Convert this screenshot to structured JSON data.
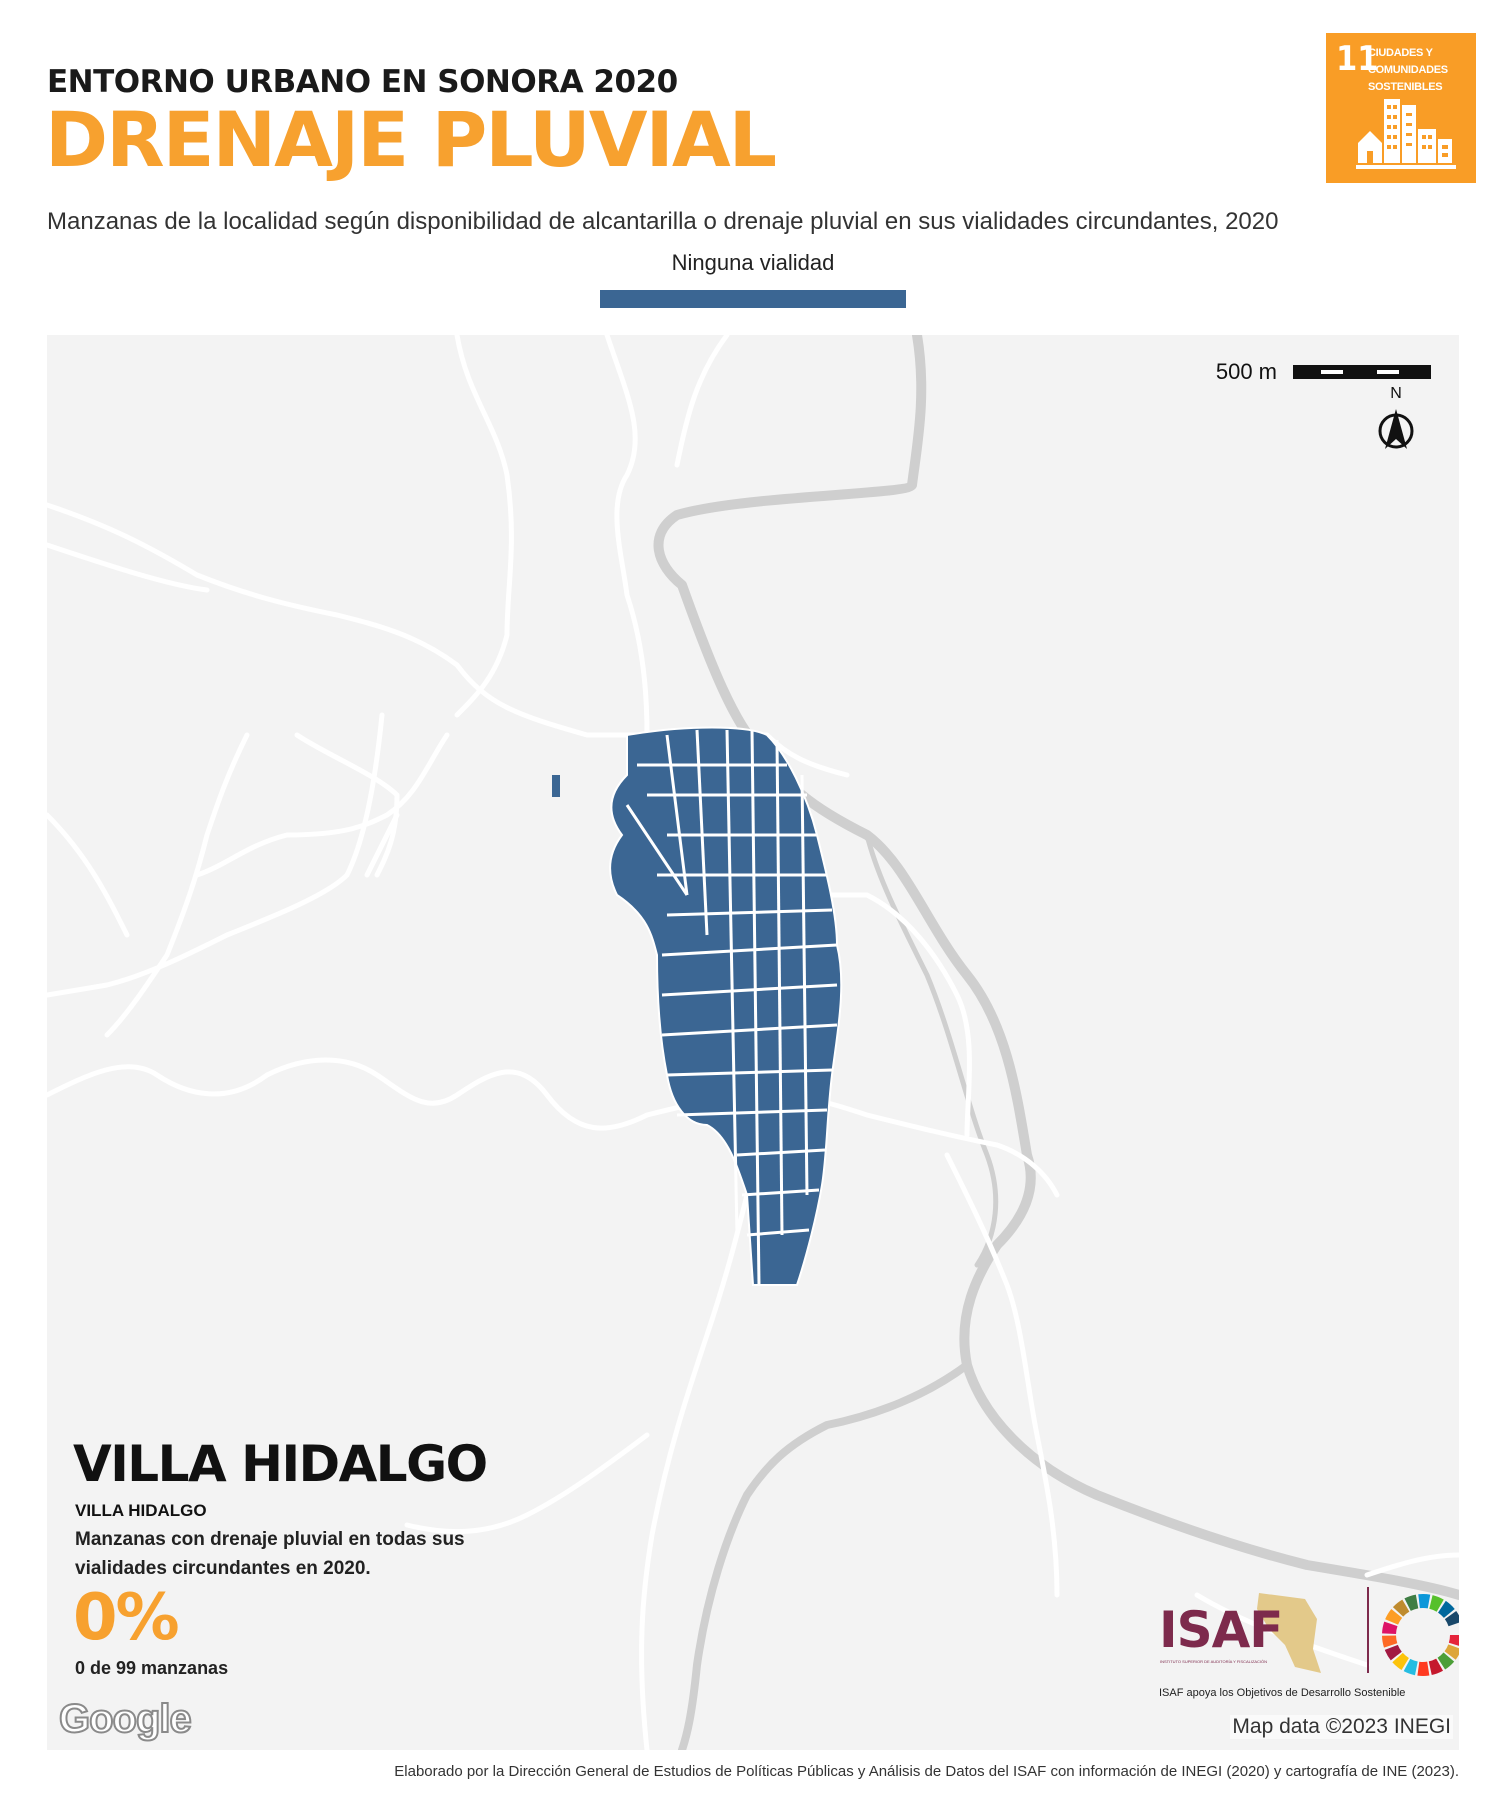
{
  "header": {
    "supertitle": "ENTORNO URBANO EN SONORA 2020",
    "title": "DRENAJE PLUVIAL",
    "subtitle": "Manzanas de la localidad según disponibilidad de alcantarilla o drenaje pluvial en sus vialidades circundantes, 2020"
  },
  "legend": {
    "label": "Ninguna vialidad",
    "color": "#3b6693"
  },
  "sdg_badge": {
    "number": "11",
    "text": "CIUDADES Y COMUNIDADES SOSTENIBLES",
    "color": "#f99d26",
    "icon": "city-buildings-icon"
  },
  "map": {
    "background": "#f3f3f3",
    "scale_label": "500 m",
    "north_label": "N",
    "attribution": "Map data ©2023 INEGI",
    "google_logo": "Google",
    "block_color": "#3b6693"
  },
  "locality": {
    "name": "VILLA HIDALGO",
    "municipality": "VILLA HIDALGO",
    "stat_description": "Manzanas con drenaje pluvial en todas sus vialidades circundantes en 2020.",
    "stat_value": "0%",
    "stat_count": "0 de 99 manzanas"
  },
  "logos": {
    "isaf": "ISAF",
    "isaf_subtitle": "INSTITUTO SUPERIOR DE AUDITORÍA Y FISCALIZACIÓN",
    "isaf_tagline": "ISAF apoya los Objetivos de Desarrollo Sostenible",
    "isaf_color": "#7d2a4c"
  },
  "footer": "Elaborado por la Dirección General de Estudios de Políticas Públicas y Análisis de Datos del ISAF con información de INEGI (2020) y cartografía de INE (2023)."
}
